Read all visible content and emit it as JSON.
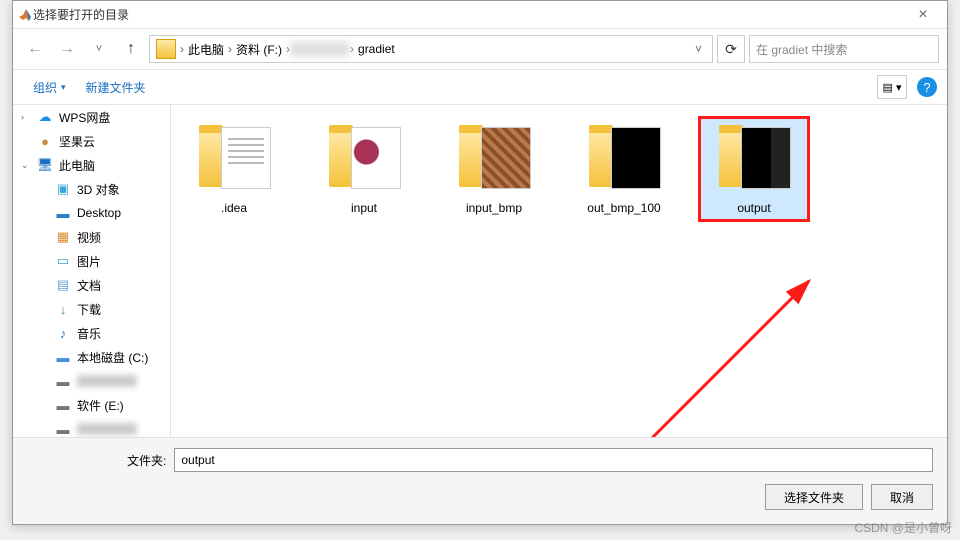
{
  "titlebar": {
    "title": "选择要打开的目录",
    "close_glyph": "×"
  },
  "nav": {
    "back": "←",
    "fwd": "→",
    "up": "↑",
    "dropdown": "˅",
    "refresh": "⟳"
  },
  "path": {
    "segments": [
      "此电脑",
      "资料 (F:)",
      "gradiet"
    ],
    "separator": "›"
  },
  "search": {
    "placeholder": "在 gradiet 中搜索"
  },
  "toolbar": {
    "organize": "组织",
    "new_folder": "新建文件夹",
    "dropdown_glyph": "▾",
    "view_glyph": "▤ ▾",
    "help_glyph": "?"
  },
  "sidebar": {
    "items": [
      {
        "label": "WPS网盘",
        "icon": "☁",
        "color": "#1a8fe3",
        "level": 1,
        "expand": "›"
      },
      {
        "label": "坚果云",
        "icon": "●",
        "color": "#c68b3f",
        "level": 1,
        "expand": ""
      },
      {
        "label": "此电脑",
        "icon": "🖥",
        "color": "#1a6fbf",
        "level": 1,
        "expand": "⌄"
      },
      {
        "label": "3D 对象",
        "icon": "▣",
        "color": "#3ba7d9",
        "level": 2
      },
      {
        "label": "Desktop",
        "icon": "▬",
        "color": "#2a7ec9",
        "level": 2
      },
      {
        "label": "视频",
        "icon": "▦",
        "color": "#d98b2a",
        "level": 2
      },
      {
        "label": "图片",
        "icon": "▭",
        "color": "#3ba7d9",
        "level": 2
      },
      {
        "label": "文档",
        "icon": "▤",
        "color": "#6aa6d9",
        "level": 2
      },
      {
        "label": "下载",
        "icon": "↓",
        "color": "#3a9b3a",
        "level": 2
      },
      {
        "label": "音乐",
        "icon": "♪",
        "color": "#2a7ec9",
        "level": 2
      },
      {
        "label": "本地磁盘 (C:)",
        "icon": "▬",
        "color": "#4a90d9",
        "level": 2
      },
      {
        "label": "blurred1",
        "icon": "▬",
        "color": "#777",
        "level": 2,
        "blur": true
      },
      {
        "label": "软件 (E:)",
        "icon": "▬",
        "color": "#777",
        "level": 2
      },
      {
        "label": "blurred2",
        "icon": "▬",
        "color": "#777",
        "level": 2,
        "blur": true
      }
    ]
  },
  "folders": [
    {
      "name": ".idea",
      "thumb": "doc",
      "selected": false
    },
    {
      "name": "input",
      "thumb": "img1",
      "selected": false
    },
    {
      "name": "input_bmp",
      "thumb": "img2",
      "selected": false
    },
    {
      "name": "out_bmp_100",
      "thumb": "img3",
      "selected": false
    },
    {
      "name": "output",
      "thumb": "img4",
      "selected": true
    }
  ],
  "footer": {
    "folder_label": "文件夹:",
    "folder_value": "output",
    "select_btn": "选择文件夹",
    "cancel_btn": "取消"
  },
  "watermark": "CSDN @是小曾呀"
}
